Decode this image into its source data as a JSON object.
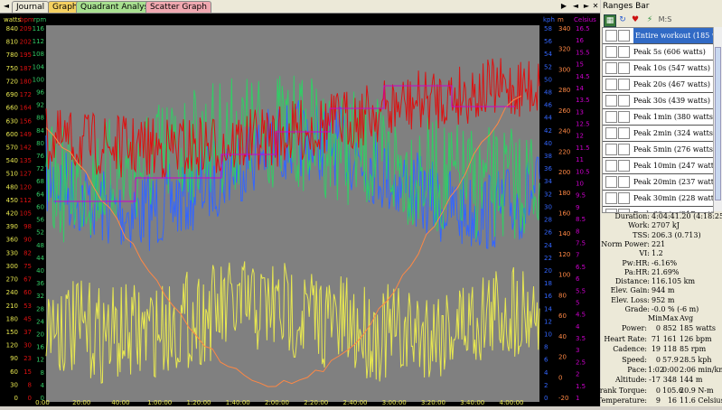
{
  "tabs": [
    {
      "label": "Journal",
      "color": "#ece9d8"
    },
    {
      "label": "Graph",
      "color": "#f4d060"
    },
    {
      "label": "Quadrant Analysis",
      "color": "#a8e090"
    },
    {
      "label": "Scatter Graph",
      "color": "#f0a8b0"
    }
  ],
  "nav": {
    "prev": "◄",
    "play": "▶",
    "prev2": "◄",
    "next2": "►",
    "close": "✕"
  },
  "chart": {
    "bg": "#808080",
    "axis_titles": {
      "watts": "watts",
      "bpm": "bpm",
      "rpm": "rpm",
      "kph": "kph",
      "m": "m",
      "celsius": "Celsius"
    },
    "watts_ticks": [
      "840",
      "810",
      "780",
      "750",
      "720",
      "690",
      "660",
      "630",
      "600",
      "570",
      "540",
      "510",
      "480",
      "450",
      "420",
      "390",
      "360",
      "330",
      "300",
      "270",
      "240",
      "210",
      "180",
      "150",
      "120",
      "90",
      "60",
      "30",
      "0"
    ],
    "bpm_ticks": [
      "209",
      "202",
      "195",
      "187",
      "180",
      "172",
      "164",
      "156",
      "149",
      "142",
      "135",
      "127",
      "120",
      "112",
      "105",
      "98",
      "90",
      "82",
      "75",
      "67",
      "60",
      "53",
      "45",
      "37",
      "30",
      "23",
      "15",
      "8",
      "0"
    ],
    "rpm_ticks": [
      "116",
      "112",
      "108",
      "104",
      "100",
      "96",
      "92",
      "88",
      "84",
      "80",
      "76",
      "72",
      "68",
      "64",
      "60",
      "56",
      "52",
      "48",
      "44",
      "40",
      "36",
      "32",
      "28",
      "24",
      "20",
      "16",
      "12",
      "8",
      "4",
      "0"
    ],
    "kph_ticks": [
      "58",
      "56",
      "54",
      "52",
      "50",
      "48",
      "46",
      "44",
      "42",
      "40",
      "38",
      "36",
      "34",
      "32",
      "30",
      "28",
      "26",
      "24",
      "22",
      "20",
      "18",
      "16",
      "14",
      "12",
      "10",
      "8",
      "6",
      "4",
      "2",
      "0"
    ],
    "m_ticks": [
      "340",
      "320",
      "300",
      "280",
      "260",
      "240",
      "220",
      "200",
      "180",
      "160",
      "140",
      "120",
      "100",
      "80",
      "60",
      "40",
      "20",
      "0",
      "-20"
    ],
    "celsius_ticks": [
      "16.5",
      "16",
      "15.5",
      "15",
      "14.5",
      "14",
      "13.5",
      "13",
      "12.5",
      "12",
      "11.5",
      "11",
      "10.5",
      "10",
      "9.5",
      "9",
      "8.5",
      "8",
      "7.5",
      "7",
      "6.5",
      "6",
      "5.5",
      "5",
      "4.5",
      "4",
      "3.5",
      "3",
      "2.5",
      "2",
      "1.5",
      "1"
    ],
    "x_ticks": [
      "0:00",
      "20:00",
      "40:00",
      "1:00:00",
      "1:20:00",
      "1:40:00",
      "2:00:00",
      "2:20:00",
      "2:40:00",
      "3:00:00",
      "3:20:00",
      "3:40:00",
      "4:00:00"
    ],
    "series_colors": {
      "power": "#e8e850",
      "heart_rate": "#dd1111",
      "cadence": "#33cc66",
      "speed": "#3366ff",
      "altitude": "#ff8844",
      "ranges": "#cc00cc"
    }
  },
  "panel": {
    "title": "Ranges Bar",
    "toolbar_icons": [
      "chart-icon",
      "refresh-icon",
      "heart-icon",
      "power-icon",
      "ms-label"
    ],
    "ms_label": "M:S",
    "ranges": [
      "Entire workout (185 watts)",
      "Peak 5s (606 watts)",
      "Peak 10s (547 watts)",
      "Peak 20s (467 watts)",
      "Peak 30s (439 watts)",
      "Peak 1min (380 watts)",
      "Peak 2min (324 watts)",
      "Peak 5min (276 watts)",
      "Peak 10min (247 watts)",
      "Peak 20min (237 watts)",
      "Peak 30min (228 watts)",
      "Peak 60min (217 watts)"
    ],
    "summary": [
      {
        "k": "Duration:",
        "v": "4:04:41.20 (4:18:25.20)"
      },
      {
        "k": "Work:",
        "v": "2707 kJ"
      },
      {
        "k": "TSS:",
        "v": "206.3 (0.713)"
      },
      {
        "k": "Norm Power:",
        "v": "221"
      },
      {
        "k": "VI:",
        "v": "1.2"
      },
      {
        "k": "Pw:HR:",
        "v": "-6.16%"
      },
      {
        "k": "Pa:HR:",
        "v": "21.69%"
      },
      {
        "k": "Distance:",
        "v": "116.105 km"
      },
      {
        "k": "Elev. Gain:",
        "v": "944 m"
      },
      {
        "k": "Elev. Loss:",
        "v": "952 m"
      },
      {
        "k": "Grade:",
        "v": "-0.0 % (-6 m)"
      }
    ],
    "stats_header": [
      "",
      "Min",
      "Max",
      "Avg"
    ],
    "stats": [
      [
        "Power:",
        "0",
        "852",
        "185 watts"
      ],
      [
        "Heart Rate:",
        "71",
        "161",
        "126 bpm"
      ],
      [
        "Cadence:",
        "19",
        "118",
        "85 rpm"
      ],
      [
        "Speed:",
        "0",
        "57.9",
        "28.5 kph"
      ],
      [
        "Pace:",
        "1:02",
        "0:00",
        "2:06 min/km"
      ],
      [
        "Altitude:",
        "-17",
        "348",
        "144 m"
      ],
      [
        "Crank Torque:",
        "0",
        "105.6",
        "20.9 N-m"
      ],
      [
        "Temperature:",
        "9",
        "16",
        "11.6 Celsius"
      ]
    ]
  }
}
